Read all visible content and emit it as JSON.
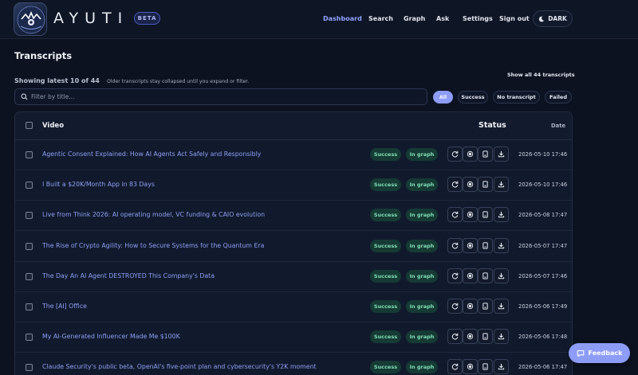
{
  "brand": {
    "name": "AYUTI",
    "badge": "BETA"
  },
  "nav": {
    "dashboard": "Dashboard",
    "search": "Search",
    "graph": "Graph",
    "ask": "Ask",
    "settings": "Settings",
    "signout": "Sign out",
    "theme": "DARK"
  },
  "page": {
    "title": "Transcripts",
    "showing": "Showing latest 10 of 44",
    "showing_sub": "Older transcripts stay collapsed until you expand or filter.",
    "show_all": "Show all 44 transcripts"
  },
  "filter": {
    "placeholder": "Filter by title..."
  },
  "chips": {
    "all": "All",
    "success": "Success",
    "no_transcript": "No transcript",
    "failed": "Failed"
  },
  "table": {
    "headers": {
      "video": "Video",
      "status": "Status",
      "date": "Date"
    },
    "rows": [
      {
        "title": "Agentic Consent Explained: How AI Agents Act Safely and Responsibly",
        "status": "Success",
        "graph": "In graph",
        "date": "2026-05-10 17:46"
      },
      {
        "title": "I Built a $20K/Month App in 83 Days",
        "status": "Success",
        "graph": "In graph",
        "date": "2026-05-10 17:46"
      },
      {
        "title": "Live from Think 2026: AI operating model, VC funding & CAIO evolution",
        "status": "Success",
        "graph": "In graph",
        "date": "2026-05-08 17:47"
      },
      {
        "title": "The Rise of Crypto Agility: How to Secure Systems for the Quantum Era",
        "status": "Success",
        "graph": "In graph",
        "date": "2026-05-07 17:47"
      },
      {
        "title": "The Day An AI Agent DESTROYED This Company's Data",
        "status": "Success",
        "graph": "In graph",
        "date": "2026-05-07 17:46"
      },
      {
        "title": "The [AI] Office",
        "status": "Success",
        "graph": "In graph",
        "date": "2026-05-06 17:49"
      },
      {
        "title": "My AI-Generated Influencer Made Me $100K",
        "status": "Success",
        "graph": "In graph",
        "date": "2026-05-06 17:48"
      },
      {
        "title": "Claude Security's public beta, OpenAI's five-point plan and cybersecurity's Y2K moment",
        "status": "Success",
        "graph": "In graph",
        "date": "2026-05-06 17:47"
      }
    ]
  },
  "feedback": {
    "label": "Feedback"
  },
  "colors": {
    "accent": "#8c9cf7",
    "link": "#8f9ff6",
    "success_bg": "#163a34",
    "success_text": "#7fe0b5",
    "background": "#0c1220"
  }
}
